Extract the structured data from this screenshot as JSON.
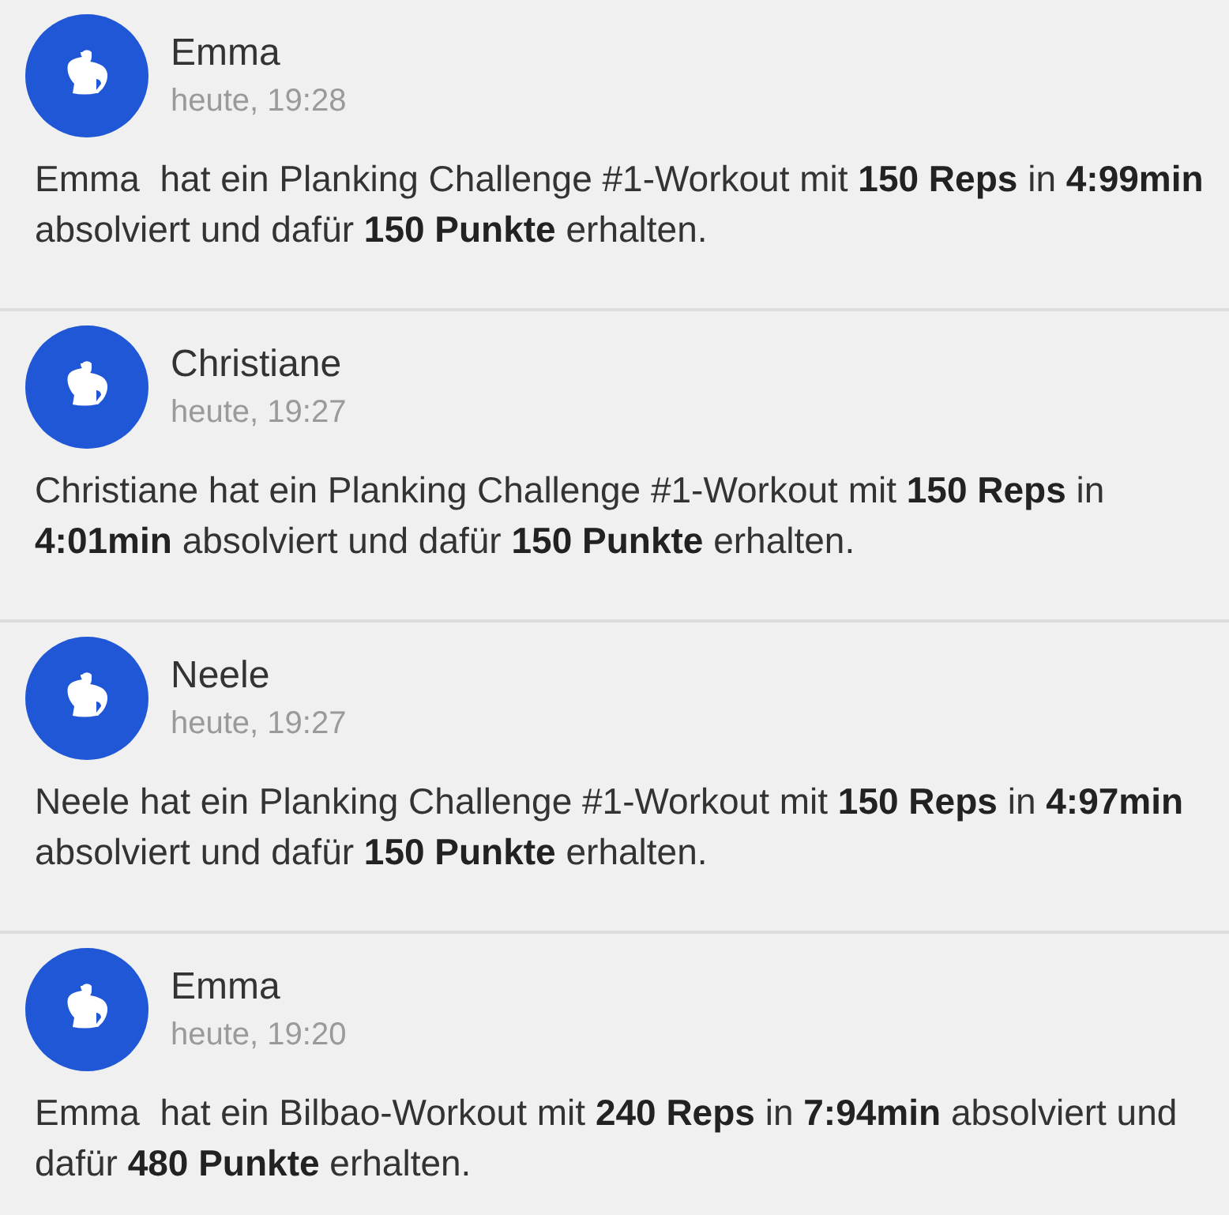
{
  "feed": [
    {
      "name": "Emma",
      "time": "heute, 19:28",
      "message": "Emma  hat ein Planking Challenge #1-Workout mit **150 Reps** in **4:99min** absolviert und dafür **150 Punkte** erhalten."
    },
    {
      "name": "Christiane",
      "time": "heute, 19:27",
      "message": "Christiane hat ein Planking Challenge #1-Workout mit **150 Reps** in **4:01min** absolviert und dafür **150 Punkte** erhalten."
    },
    {
      "name": "Neele",
      "time": "heute, 19:27",
      "message": "Neele hat ein Planking Challenge #1-Workout mit **150 Reps** in **4:97min** absolviert und dafür **150 Punkte** erhalten."
    },
    {
      "name": "Emma",
      "time": "heute, 19:20",
      "message": "Emma  hat ein Bilbao-Workout mit **240 Reps** in **7:94min** absolviert und dafür **480 Punkte** erhalten."
    }
  ]
}
